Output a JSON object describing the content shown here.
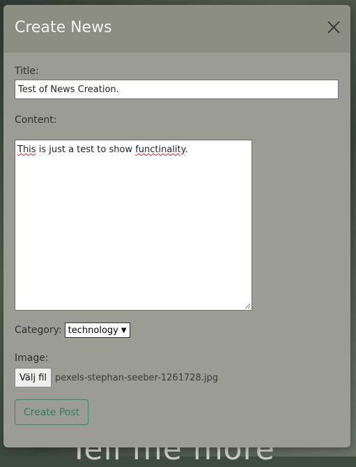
{
  "modal": {
    "title": "Create News",
    "close_icon": "close-icon"
  },
  "form": {
    "title_label": "Title:",
    "title_value": "Test of News Creation.",
    "content_label": "Content:",
    "content_value_part1": "This",
    "content_value_part2": " is just a test to show ",
    "content_value_part3": "functinality",
    "content_value_part4": ".",
    "category_label": "Category:",
    "category_selected": "technology",
    "image_label": "Image:",
    "file_button_label": "Välj fil",
    "file_name": "pexels-stephan-seeber-1261728.jpg",
    "submit_label": "Create Post"
  },
  "background": {
    "visible_text": "Tell me more"
  },
  "colors": {
    "modal_bg": "#9b9d95",
    "header_bg": "#8c8e83",
    "submit_accent": "#2d7f58"
  }
}
